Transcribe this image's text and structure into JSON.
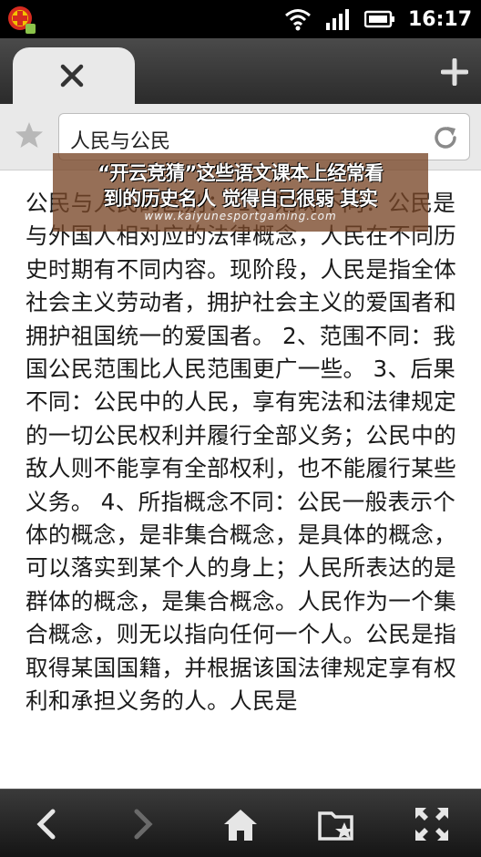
{
  "status": {
    "time": "16:17"
  },
  "tab": {
    "close_icon": "close-icon",
    "new_tab_icon": "plus-icon"
  },
  "urlbar": {
    "text": "人民与公民"
  },
  "article": {
    "text": "公民与人民的区别： 1、范畴不同：公民是与外国人相对应的法律概念，人民在不同历史时期有不同内容。现阶段，人民是指全体社会主义劳动者，拥护社会主义的爱国者和拥护祖国统一的爱国者。 2、范围不同：我国公民范围比人民范围更广一些。 3、后果不同：公民中的人民，享有宪法和法律规定的一切公民权利并履行全部义务；公民中的敌人则不能享有全部权利，也不能履行某些义务。 4、所指概念不同：公民一般表示个体的概念，是非集合概念，是具体的概念，可以落实到某个人的身上；人民所表达的是群体的概念，是集合概念。人民作为一个集合概念，则无以指向任何一个人。公民是指取得某国国籍，并根据该国法律规定享有权利和承担义务的人。人民是"
  },
  "watermark": {
    "line1": "“开云竞猜”这些语文课本上经常看",
    "line2": "到的历史名人 觉得自己很弱 其实",
    "url": "www.kaiyunesportgaming.com"
  },
  "colors": {
    "accent_red": "#d62b1f",
    "toolbar_dark": "#2b2b2b"
  }
}
